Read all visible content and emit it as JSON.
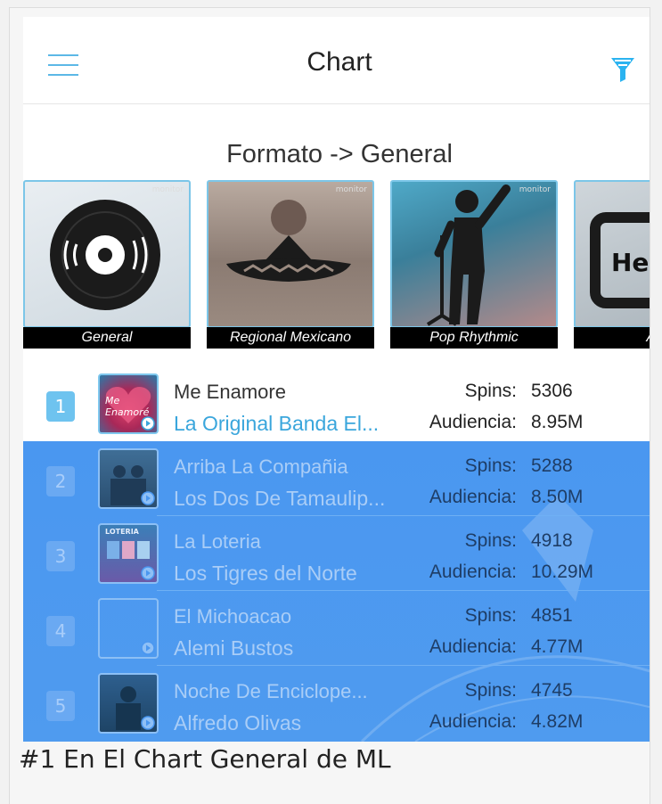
{
  "header": {
    "title": "Chart",
    "menu_icon": "hamburger-menu-icon",
    "filter_icon": "funnel-filter-icon",
    "accent": "#2bb3f0"
  },
  "format_heading": "Formato -> General",
  "genres": [
    {
      "label": "General",
      "image_tag": "monitor"
    },
    {
      "label": "Regional Mexicano",
      "image_tag": "monitor"
    },
    {
      "label": "Pop Rhythmic",
      "image_tag": "monitor"
    },
    {
      "label": "A",
      "image_tag": "He"
    }
  ],
  "chart": {
    "spins_label": "Spins:",
    "audience_label": "Audiencia:",
    "rows": [
      {
        "rank": "1",
        "title": "Me Enamore",
        "artist": "La Original Banda El...",
        "spins": "5306",
        "audience": "8.95M",
        "cover_text": "Me Enamoré"
      },
      {
        "rank": "2",
        "title": "Arriba La Compañia",
        "artist": "Los Dos De Tamaulip...",
        "spins": "5288",
        "audience": "8.50M",
        "cover_text": ""
      },
      {
        "rank": "3",
        "title": "La Loteria",
        "artist": "Los Tigres del Norte",
        "spins": "4918",
        "audience": "10.29M",
        "cover_text": "LOTERIA"
      },
      {
        "rank": "4",
        "title": "El Michoacao",
        "artist": "Alemi Bustos",
        "spins": "4851",
        "audience": "4.77M",
        "cover_text": ""
      },
      {
        "rank": "5",
        "title": "Noche De Enciclope...",
        "artist": "Alfredo Olivas",
        "spins": "4745",
        "audience": "4.82M",
        "cover_text": ""
      }
    ]
  },
  "caption": "#1 En El Chart General de ML",
  "colors": {
    "overlay": "#4a97f0",
    "rank_badge": "#6ec3ef",
    "artist_text": "#3aa6dc"
  }
}
